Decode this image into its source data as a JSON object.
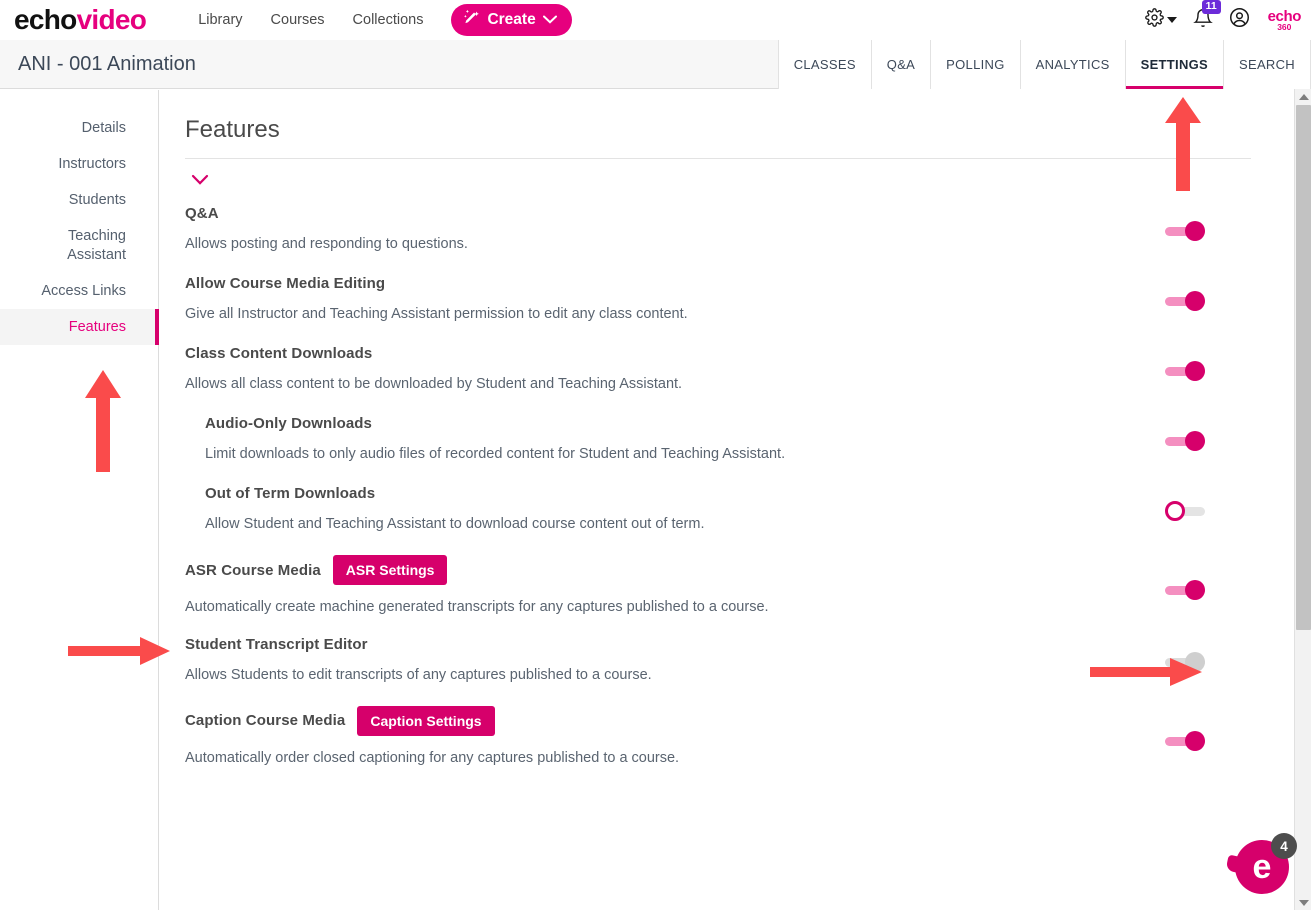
{
  "topnav": {
    "logo": {
      "part1": "echo",
      "part2": "video"
    },
    "links": [
      {
        "label": "Library"
      },
      {
        "label": "Courses"
      },
      {
        "label": "Collections"
      }
    ],
    "create_label": "Create",
    "notifications_count": "11",
    "brand_mark": {
      "top": "echo",
      "bottom": "360"
    }
  },
  "course": {
    "title": "ANI - 001 Animation",
    "tabs": [
      {
        "label": "CLASSES",
        "active": false
      },
      {
        "label": "Q&A",
        "active": false
      },
      {
        "label": "POLLING",
        "active": false
      },
      {
        "label": "ANALYTICS",
        "active": false
      },
      {
        "label": "SETTINGS",
        "active": true
      },
      {
        "label": "SEARCH",
        "active": false
      }
    ]
  },
  "sidebar": {
    "items": [
      {
        "label": "Details",
        "active": false
      },
      {
        "label": "Instructors",
        "active": false
      },
      {
        "label": "Students",
        "active": false
      },
      {
        "label": "Teaching Assistant",
        "active": false
      },
      {
        "label": "Access Links",
        "active": false
      },
      {
        "label": "Features",
        "active": true
      }
    ]
  },
  "panel": {
    "title": "Features",
    "features": [
      {
        "title": "Q&A",
        "description": "Allows posting and responding to questions.",
        "toggle": "on",
        "button": null,
        "indent": false
      },
      {
        "title": "Allow Course Media Editing",
        "description": "Give all Instructor and Teaching Assistant permission to edit any class content.",
        "toggle": "on",
        "button": null,
        "indent": false
      },
      {
        "title": "Class Content Downloads",
        "description": "Allows all class content to be downloaded by Student and Teaching Assistant.",
        "toggle": "on",
        "button": null,
        "indent": false
      },
      {
        "title": "Audio-Only Downloads",
        "description": "Limit downloads to only audio files of recorded content for Student and Teaching Assistant.",
        "toggle": "on",
        "button": null,
        "indent": true
      },
      {
        "title": "Out of Term Downloads",
        "description": "Allow Student and Teaching Assistant to download course content out of term.",
        "toggle": "off",
        "button": null,
        "indent": true
      },
      {
        "title": "ASR Course Media",
        "description": "Automatically create machine generated transcripts for any captures published to a course.",
        "toggle": "on",
        "button": "ASR Settings",
        "indent": false
      },
      {
        "title": "Student Transcript Editor",
        "description": "Allows Students to edit transcripts of any captures published to a course.",
        "toggle": "disabled",
        "button": null,
        "indent": false
      },
      {
        "title": "Caption Course Media",
        "description": "Automatically order closed captioning for any captures published to a course.",
        "toggle": "on",
        "button": "Caption Settings",
        "indent": false
      }
    ]
  },
  "help": {
    "glyph": "e",
    "badge": "4"
  },
  "colors": {
    "brand_pink": "#e6007e",
    "button_pink": "#d6006b",
    "annotation_red": "#fa4b4b",
    "badge_purple": "#6c2bd9"
  }
}
